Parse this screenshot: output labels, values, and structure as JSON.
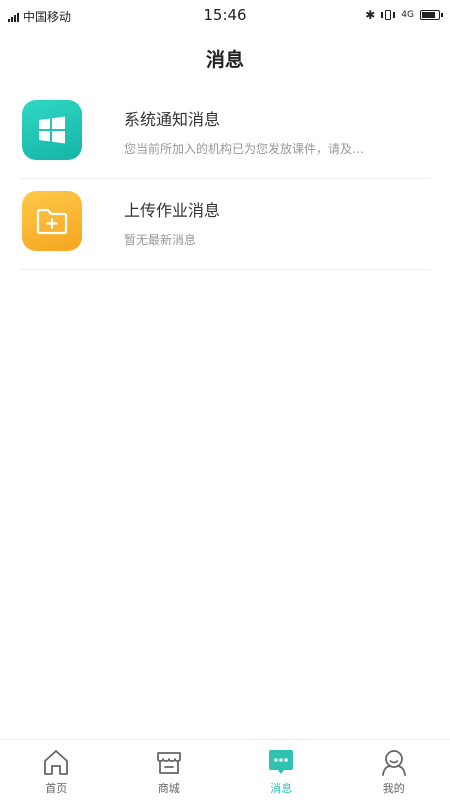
{
  "status_bar": {
    "carrier": "中国移动",
    "time": "15:46",
    "network": "4G"
  },
  "header": {
    "title": "消息"
  },
  "messages": [
    {
      "title": "系统通知消息",
      "desc": "您当前所加入的机构已为您发放课件，请及…",
      "icon": "windows-icon",
      "color": "#1fc3b3"
    },
    {
      "title": "上传作业消息",
      "desc": "暂无最新消息",
      "icon": "folder-add-icon",
      "color": "#f7b02c"
    }
  ],
  "tabs": [
    {
      "label": "首页",
      "icon": "home-icon"
    },
    {
      "label": "商城",
      "icon": "store-icon"
    },
    {
      "label": "消息",
      "icon": "message-icon",
      "active": true
    },
    {
      "label": "我的",
      "icon": "user-icon"
    }
  ],
  "colors": {
    "accent": "#2fc2b0"
  },
  "battery_level": 0.85
}
